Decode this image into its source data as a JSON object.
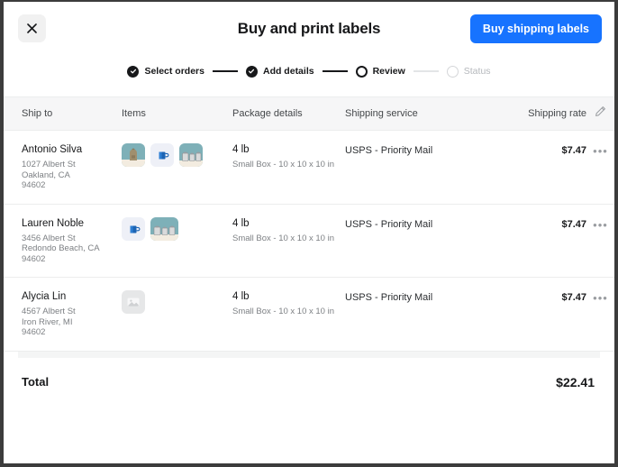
{
  "header": {
    "title": "Buy and print labels",
    "close_icon": "close-icon",
    "primary_button": "Buy shipping labels"
  },
  "stepper": {
    "steps": [
      {
        "label": "Select orders",
        "state": "done"
      },
      {
        "label": "Add details",
        "state": "done"
      },
      {
        "label": "Review",
        "state": "active"
      },
      {
        "label": "Status",
        "state": "todo"
      }
    ]
  },
  "table": {
    "columns": {
      "ship_to": "Ship to",
      "items": "Items",
      "package_details": "Package details",
      "shipping_service": "Shipping service",
      "shipping_rate": "Shipping rate"
    },
    "edit_icon": "pencil-icon",
    "menu_icon": "overflow-menu-icon",
    "rows": [
      {
        "name": "Antonio Silva",
        "address_line1": "1027 Albert St",
        "address_line2": "Oakland, CA",
        "address_line3": "94602",
        "weight": "4 lb",
        "box": "Small Box - 10 x 10 x 10 in",
        "service": "USPS - Priority Mail",
        "rate": "$7.47",
        "menu": "•••",
        "thumbs": [
          "backpack-thumbnail",
          "mug-thumbnail",
          "shakers-thumbnail"
        ]
      },
      {
        "name": "Lauren Noble",
        "address_line1": "3456 Albert St",
        "address_line2": "Redondo Beach, CA",
        "address_line3": "94602",
        "weight": "4 lb",
        "box": "Small Box - 10 x 10 x 10 in",
        "service": "USPS - Priority Mail",
        "rate": "$7.47",
        "menu": "•••",
        "thumbs": [
          "mug-thumbnail",
          "shakers-thumbnail"
        ]
      },
      {
        "name": "Alycia Lin",
        "address_line1": "4567 Albert St",
        "address_line2": "Iron River, MI",
        "address_line3": "94602",
        "weight": "4 lb",
        "box": "Small Box - 10 x 10 x 10 in",
        "service": "USPS - Priority Mail",
        "rate": "$7.47",
        "menu": "•••",
        "thumbs": [
          "image-placeholder-thumbnail"
        ]
      }
    ]
  },
  "total": {
    "label": "Total",
    "value": "$22.41"
  },
  "colors": {
    "accent": "#1773ff",
    "header_bg": "#f6f6f7",
    "text": "#17181a",
    "muted": "#7d8084",
    "border": "#eceded"
  }
}
